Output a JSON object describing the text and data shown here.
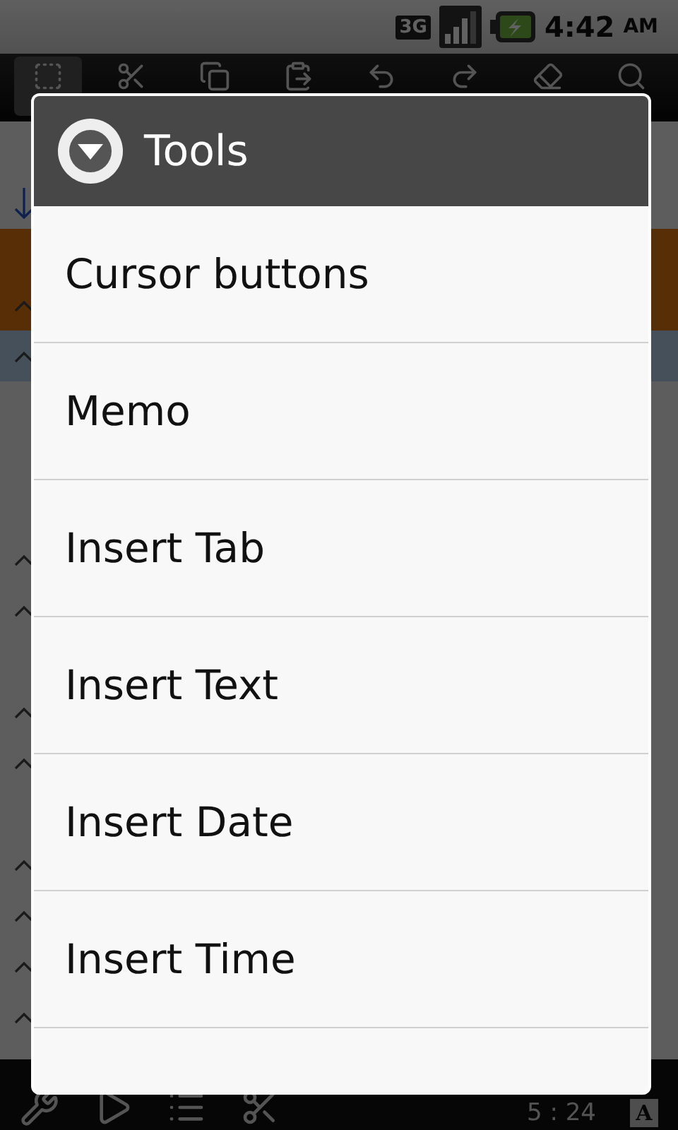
{
  "status_bar": {
    "network": "3G",
    "time": "4:42",
    "meridiem": "AM"
  },
  "toolbar": [
    {
      "selected": true
    },
    {
      "selected": false
    },
    {
      "selected": false
    },
    {
      "selected": false
    },
    {
      "selected": false
    },
    {
      "selected": false
    },
    {
      "selected": false
    },
    {
      "selected": false
    }
  ],
  "editor": {
    "lines": [
      {
        "kind": "plain"
      },
      {
        "kind": "arrow"
      },
      {
        "kind": "highlight"
      },
      {
        "kind": "highlight-marker"
      },
      {
        "kind": "selected-marker"
      },
      {
        "kind": "plain"
      },
      {
        "kind": "plain"
      },
      {
        "kind": "plain"
      },
      {
        "kind": "marker"
      },
      {
        "kind": "marker"
      },
      {
        "kind": "plain"
      },
      {
        "kind": "marker"
      },
      {
        "kind": "marker"
      },
      {
        "kind": "plain"
      },
      {
        "kind": "marker"
      },
      {
        "kind": "marker"
      },
      {
        "kind": "marker"
      },
      {
        "kind": "marker"
      }
    ]
  },
  "bottom_bar": {
    "position": "5 : 24",
    "font_key": "A"
  },
  "dialog": {
    "title": "Tools",
    "items": [
      {
        "label": "Cursor buttons"
      },
      {
        "label": "Memo"
      },
      {
        "label": "Insert Tab"
      },
      {
        "label": "Insert Text"
      },
      {
        "label": "Insert Date"
      },
      {
        "label": "Insert Time"
      }
    ]
  }
}
